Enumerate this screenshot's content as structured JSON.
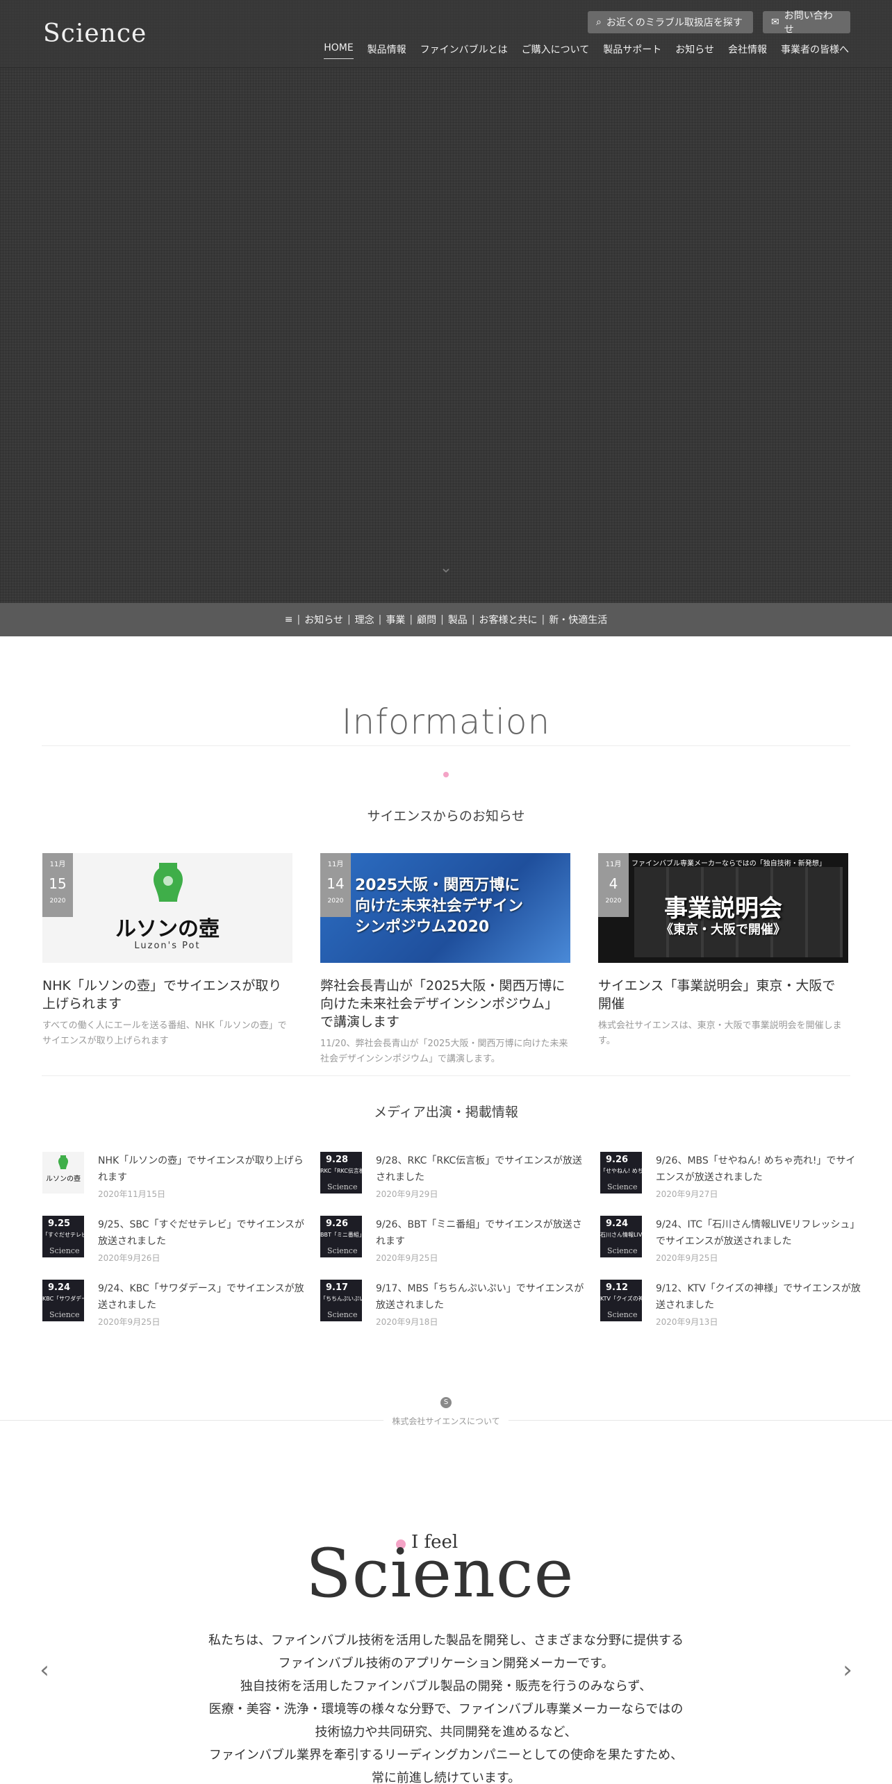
{
  "header": {
    "logo": "Science",
    "store_button": "お近くのミラブル取扱店を探す",
    "contact_button": "お問い合わせ",
    "nav": [
      "HOME",
      "製品情報",
      "ファインバブルとは",
      "ご購入について",
      "製品サポート",
      "お知らせ",
      "会社情報",
      "事業者の皆様へ"
    ]
  },
  "subnav": {
    "menu_glyph": "≡",
    "links": [
      "お知らせ",
      "理念",
      "事業",
      "顧問",
      "製品",
      "お客様と共に",
      "新・快適生活"
    ]
  },
  "info": {
    "title": "Information",
    "news_heading": "サイエンスからのお知らせ",
    "cards": [
      {
        "month": "11月",
        "day": "15",
        "year": "2020",
        "image_text": "ルソンの壺",
        "image_sub": "Luzon's Pot",
        "title": "NHK「ルソンの壺」でサイエンスが取り上げられます",
        "desc": "すべての働く人にエールを送る番組、NHK「ルソンの壺」でサイエンスが取り上げられます"
      },
      {
        "month": "11月",
        "day": "14",
        "year": "2020",
        "image_lines": [
          "2025大阪・関西万博に",
          "向けた未来社会デザイン",
          "シンポジウム2020"
        ],
        "title": "弊社会長青山が「2025大阪・関西万博に向けた未来社会デザインシンポジウム」で講演します",
        "desc": "11/20、弊社会長青山が「2025大阪・関西万博に向けた未来社会デザインシンポジウム」で講演します。"
      },
      {
        "month": "11月",
        "day": "4",
        "year": "2020",
        "image_top": "ファインバブル専業メーカーならではの「独自技術・新発想」",
        "image_main": "事業説明会",
        "image_sub": "《東京・大阪で開催》",
        "title": "サイエンス「事業説明会」東京・大阪で開催",
        "desc": "株式会社サイエンスは、東京・大阪で事業説明会を開催します。"
      }
    ],
    "media_heading": "メディア出演・掲載情報",
    "media": [
      {
        "thumb_date": "",
        "thumb_text": "ルソンの壺",
        "title": "NHK「ルソンの壺」でサイエンスが取り上げられます",
        "date": "2020年11月15日"
      },
      {
        "thumb_date": "9.28",
        "thumb_text": "RKC「RKC伝言板」",
        "title": "9/28、RKC「RKC伝言板」でサイエンスが放送されました",
        "date": "2020年9月29日"
      },
      {
        "thumb_date": "9.26",
        "thumb_text": "「せやねん! めちゃ売れ!」",
        "title": "9/26、MBS「せやねん! めちゃ売れ!」でサイエンスが放送されました",
        "date": "2020年9月27日"
      },
      {
        "thumb_date": "9.25",
        "thumb_text": "「すぐだせテレビ」",
        "title": "9/25、SBC「すぐだせテレビ」でサイエンスが放送されました",
        "date": "2020年9月26日"
      },
      {
        "thumb_date": "9.26",
        "thumb_text": "BBT「ミニ番組」",
        "title": "9/26、BBT「ミニ番組」でサイエンスが放送されます",
        "date": "2020年9月25日"
      },
      {
        "thumb_date": "9.24",
        "thumb_text": "石川さん情報LIVEリ",
        "title": "9/24、ITC「石川さん情報LIVEリフレッシュ」でサイエンスが放送されました",
        "date": "2020年9月25日"
      },
      {
        "thumb_date": "9.24",
        "thumb_text": "KBC「サワダデース」",
        "title": "9/24、KBC「サワダデース」でサイエンスが放送されました",
        "date": "2020年9月25日"
      },
      {
        "thumb_date": "9.17",
        "thumb_text": "「ちちんぷいぷい」",
        "title": "9/17、MBS「ちちんぷいぷい」でサイエンスが放送されました",
        "date": "2020年9月18日"
      },
      {
        "thumb_date": "9.12",
        "thumb_text": "KTV「クイズの神様」",
        "title": "9/12、KTV「クイズの神様」でサイエンスが放送されました",
        "date": "2020年9月13日"
      }
    ]
  },
  "about": {
    "label": "株式会社サイエンスについて",
    "logo_tag": "I feel",
    "logo_word": "Science",
    "intro_lines": [
      "私たちは、ファインバブル技術を活用した製品を開発し、さまざまな分野に提供する",
      "ファインバブル技術のアプリケーション開発メーカーです。",
      "独自技術を活用したファインバブル製品の開発・販売を行うのみならず、",
      "医療・美容・洗浄・環境等の様々な分野で、ファインバブル専業メーカーならではの",
      "技術協力や共同研究、共同開発を進めるなど、",
      "ファインバブル業界を牽引するリーディングカンパニーとしての使命を果たすため、",
      "常に前進し続けています。"
    ]
  },
  "colors": {
    "hero": "#3b3b3b",
    "subbar": "#5a5a5a",
    "accent_pink": "#f4a3c6",
    "date_badge": "#9a9a9a"
  }
}
